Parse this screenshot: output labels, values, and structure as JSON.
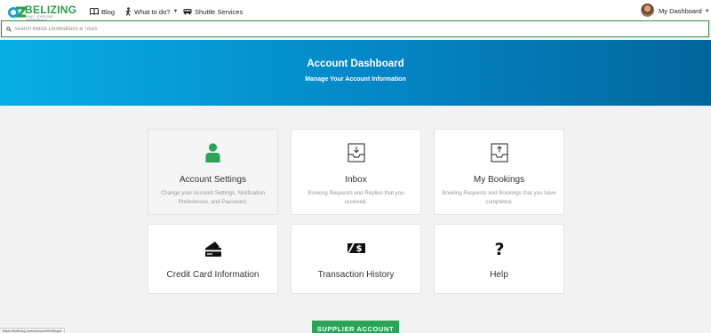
{
  "brand": {
    "name": "BELIZING",
    "tagline": "FIND · EXPLORE · EXPERIENCE"
  },
  "nav": {
    "blog": "Blog",
    "what_to_do": "What to do?",
    "shuttle": "Shuttle Services",
    "my_dashboard": "My Dashboard"
  },
  "search": {
    "placeholder": "Search Belize Destinations & Tours",
    "value": ""
  },
  "hero": {
    "title": "Account Dashboard",
    "subtitle": "Manage Your Account Information"
  },
  "cards": [
    {
      "title": "Account Settings",
      "description": "Change your Account Settings, Notification Preferences, and Password.",
      "icon": "user-icon",
      "icon_color": "#2aa457"
    },
    {
      "title": "Inbox",
      "description": "Booking Requests and Replies that you received.",
      "icon": "inbox-icon"
    },
    {
      "title": "My Bookings",
      "description": "Booking Requests and Bookings that you have completed.",
      "icon": "outbox-icon"
    },
    {
      "title": "Credit Card Information",
      "icon": "credit-card-icon"
    },
    {
      "title": "Transaction History",
      "icon": "money-icon"
    },
    {
      "title": "Help",
      "icon": "question-icon"
    }
  ],
  "supplier_button": "SUPPLIER ACCOUNT",
  "status_bar": "https://belizing.com/Account/Settings/",
  "colors": {
    "accent_green": "#2aa457",
    "hero_start": "#08aee6",
    "hero_end": "#02669c"
  }
}
